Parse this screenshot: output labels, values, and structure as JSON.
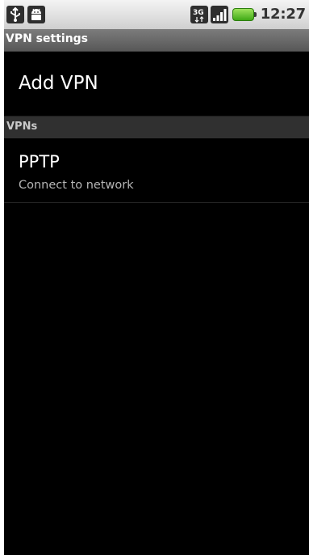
{
  "status_bar": {
    "time": "12:27",
    "network_type": "3G",
    "icons": [
      "usb-icon",
      "android-icon",
      "network-3g-icon",
      "signal-icon",
      "battery-icon"
    ],
    "colors": {
      "battery": "#4caf1f"
    }
  },
  "title_bar": {
    "title": "VPN settings"
  },
  "add_vpn": {
    "label": "Add VPN"
  },
  "vpns_section": {
    "header": "VPNs",
    "items": [
      {
        "name": "PPTP",
        "status": "Connect to network"
      }
    ]
  }
}
